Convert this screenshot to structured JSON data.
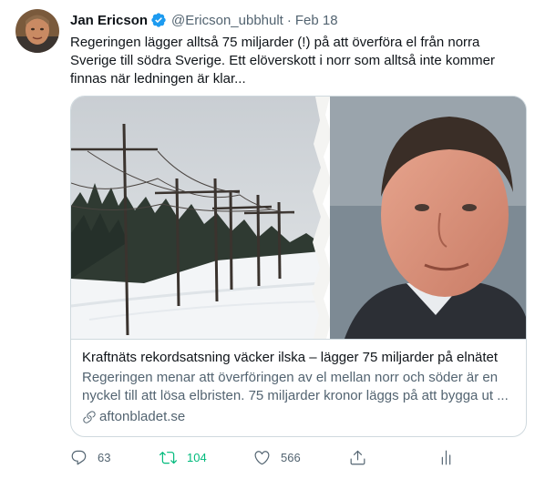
{
  "author": {
    "name": "Jan Ericson",
    "handle": "@Ericson_ubbhult",
    "date": "Feb 18",
    "separator": "·"
  },
  "tweet": {
    "text": "Regeringen lägger alltså 75 miljarder (!) på att överföra el från norra Sverige till södra Sverige. Ett elöverskott i norr som alltså inte kommer finnas när ledningen är klar..."
  },
  "card": {
    "title": "Kraftnäts rekordsatsning väcker ilska – lägger 75 miljarder på elnätet",
    "description": "Regeringen menar att överföringen av el mellan norr och söder är en nyckel till att lösa elbristen. 75 miljarder kronor läggs på att bygga ut ...",
    "domain": "aftonbladet.se",
    "image_icon": "link-icon"
  },
  "actions": {
    "reply_count": "63",
    "retweet_count": "104",
    "like_count": "566",
    "share_icon": "share-icon",
    "analytics_icon": "analytics-icon"
  },
  "colors": {
    "accent": "#1d9bf0",
    "retweet_active": "#00ba7c",
    "secondary_text": "#536471",
    "border": "#cfd9de"
  }
}
